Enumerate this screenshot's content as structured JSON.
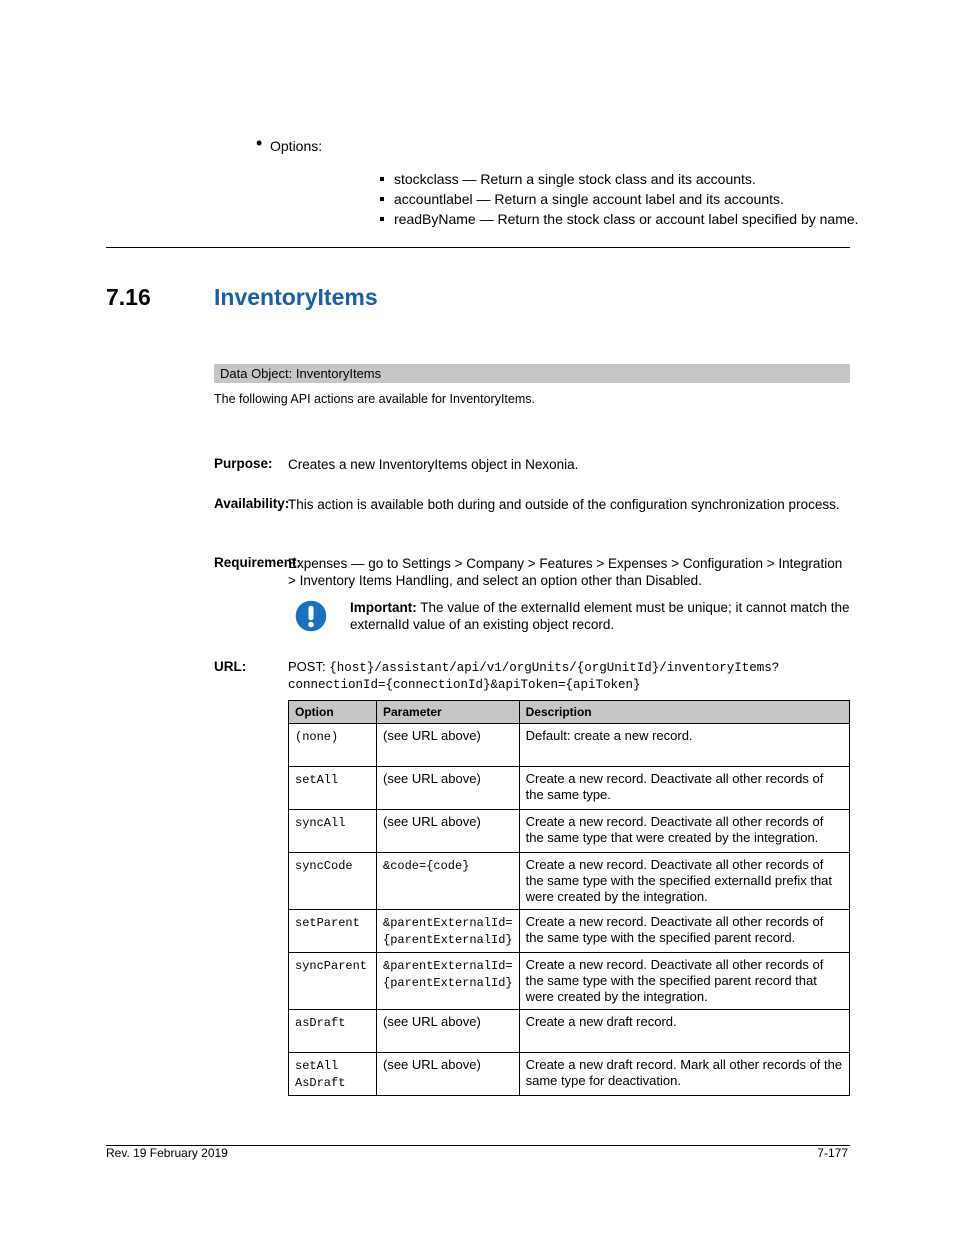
{
  "top_bullet": {
    "label": "Options:",
    "items": [
      "stockclass — Return a single stock class and its accounts.",
      "accountlabel — Return a single account label and its accounts.",
      "readByName — Return the stock class or account label specified by name."
    ]
  },
  "section": {
    "number": "7.16",
    "title": "InventoryItems",
    "band_label": "Data Object: InventoryItems",
    "band_note": "The following API actions are available for InventoryItems."
  },
  "purpose": {
    "label": "Purpose:",
    "text": "Creates a new InventoryItems object in Nexonia."
  },
  "availability": {
    "label": "Availability:",
    "text": "This action is available both during and outside of the configuration synchronization process."
  },
  "requirement": {
    "label": "Requirement:",
    "text": "Expenses — go to Settings > Company > Features > Expenses > Configuration > Integration > Inventory Items Handling, and select an option other than Disabled."
  },
  "important": {
    "label": "Important:",
    "text": "The value of the externalId element must be unique; it cannot match the externalId value of an existing object record."
  },
  "url": {
    "label": "URL:",
    "prefix": "POST:",
    "line1": "{host}/assistant/api/v1/orgUnits/{orgUnitId}/inventoryItems?",
    "line2": "connectionId={connectionId}&apiToken={apiToken}"
  },
  "table": {
    "headers": [
      "Option",
      "Parameter",
      "Description"
    ],
    "rows": [
      [
        {
          "mono": "(none)",
          "text": ""
        },
        {
          "mono": "",
          "text": "(see URL above)"
        },
        {
          "mono": "",
          "text": "Default: create a new record."
        }
      ],
      [
        {
          "mono": "setAll",
          "text": ""
        },
        {
          "mono": "",
          "text": "(see URL above)"
        },
        {
          "mono": "",
          "text": "Create a new record. Deactivate all other records of the same type."
        }
      ],
      [
        {
          "mono": "syncAll",
          "text": ""
        },
        {
          "mono": "",
          "text": "(see URL above)"
        },
        {
          "mono": "",
          "text": "Create a new record. Deactivate all other records of the same type that were created by the integration."
        }
      ],
      [
        {
          "mono": "syncCode",
          "text": ""
        },
        {
          "mono": "&code={code}",
          "text": ""
        },
        {
          "mono": "",
          "text": "Create a new record. Deactivate all other records of the same type with the specified externalId prefix that were created by the integration."
        }
      ],
      [
        {
          "mono": "setParent",
          "text": ""
        },
        {
          "mono": "&parentExternalId=\n{parentExternalId}",
          "text": ""
        },
        {
          "mono": "",
          "text": "Create a new record. Deactivate all other records of the same type with the specified parent record."
        }
      ],
      [
        {
          "mono": "syncParent",
          "text": ""
        },
        {
          "mono": "&parentExternalId=\n{parentExternalId}",
          "text": ""
        },
        {
          "mono": "",
          "text": "Create a new record. Deactivate all other records of the same type with the specified parent record that were created by the integration."
        }
      ],
      [
        {
          "mono": "asDraft",
          "text": ""
        },
        {
          "mono": "",
          "text": "(see URL above)"
        },
        {
          "mono": "",
          "text": "Create a new draft record."
        }
      ],
      [
        {
          "mono": "setAll\nAsDraft",
          "text": ""
        },
        {
          "mono": "",
          "text": "(see URL above)"
        },
        {
          "mono": "",
          "text": "Create a new draft record. Mark all other records of the same type for deactivation."
        }
      ]
    ]
  },
  "footer": {
    "left": "Rev. 19 February 2019",
    "right": "7-177"
  }
}
